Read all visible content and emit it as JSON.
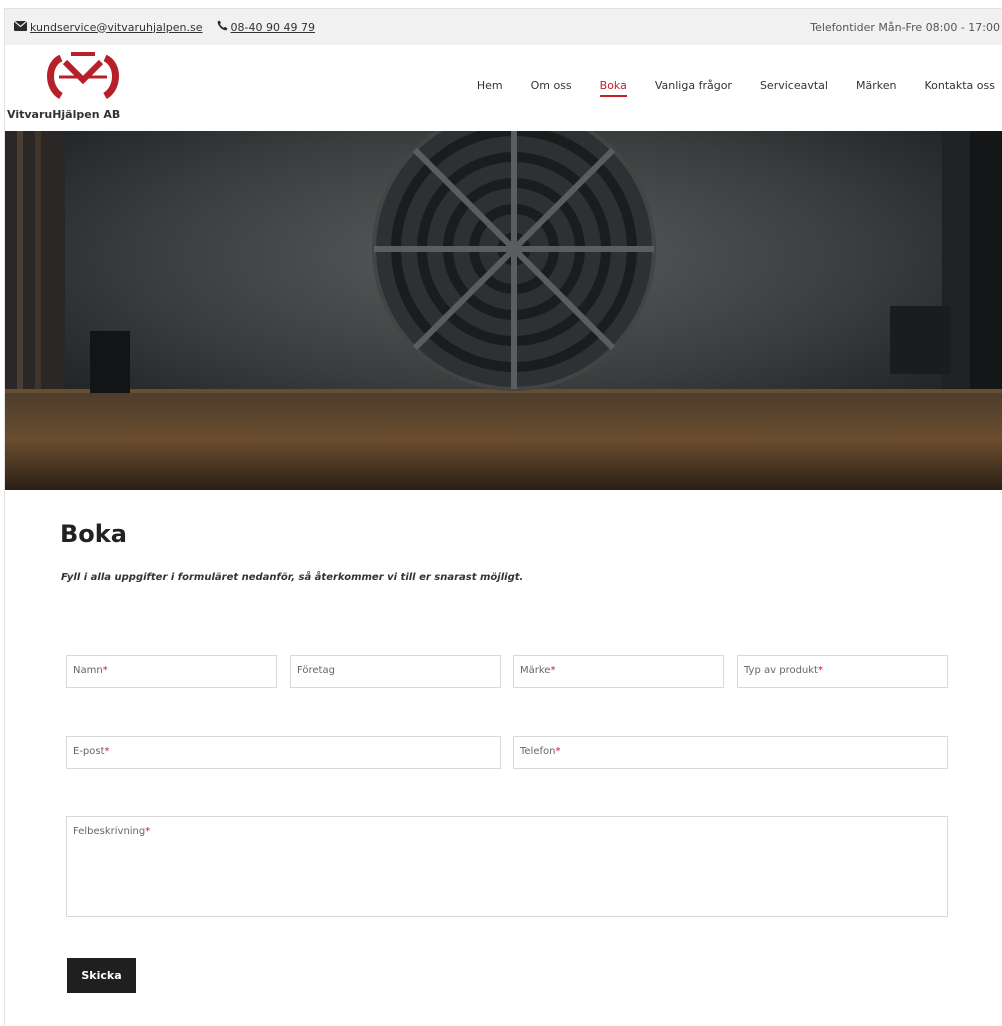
{
  "topbar": {
    "email": "kundservice@vitvaruhjalpen.se",
    "phone": "08-40 90 49 79",
    "hours": "Telefontider Mån-Fre 08:00 - 17:00"
  },
  "header": {
    "brand": "VitvaruHjälpen AB",
    "nav": [
      {
        "label": "Hem"
      },
      {
        "label": "Om oss"
      },
      {
        "label": "Boka"
      },
      {
        "label": "Vanliga frågor"
      },
      {
        "label": "Serviceavtal"
      },
      {
        "label": "Märken"
      },
      {
        "label": "Kontakta oss"
      }
    ],
    "active_nav": "Boka"
  },
  "main": {
    "title": "Boka",
    "intro": "Fyll i alla uppgifter i formuläret nedanför, så återkommer vi till er snarast möjligt.",
    "form": {
      "namn": {
        "label": "Namn",
        "required": "*"
      },
      "foretag": {
        "label": "Företag"
      },
      "marke": {
        "label": "Märke",
        "required": "*"
      },
      "typ": {
        "label": "Typ av produkt",
        "required": "*"
      },
      "epost": {
        "label": "E-post",
        "required": "*"
      },
      "telefon": {
        "label": "Telefon",
        "required": "*"
      },
      "felbeskrivning": {
        "label": "Felbeskrivning",
        "required": "*"
      },
      "submit_label": "Skicka"
    }
  },
  "colors": {
    "accent": "#c11f2b",
    "topbar_bg": "#f1f1f1",
    "button_bg": "#1f1f1f"
  }
}
